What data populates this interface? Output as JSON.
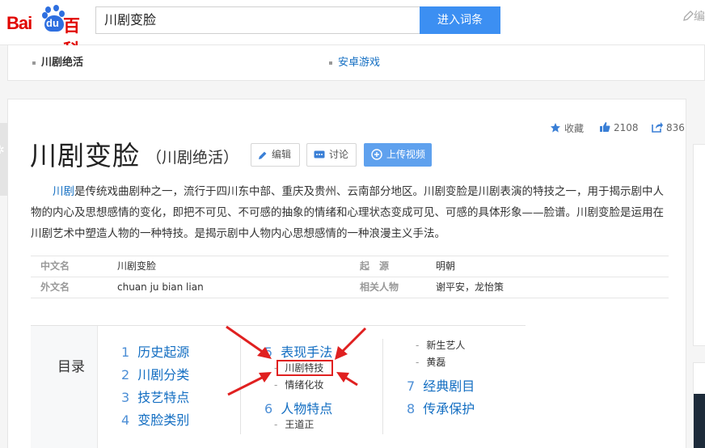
{
  "header": {
    "logo": {
      "bai": "Bai",
      "du": "du",
      "baike": "百科"
    },
    "search_value": "川剧变脸",
    "search_button": "进入词条",
    "edit_partial": "编"
  },
  "poly_links": [
    {
      "label": "川剧绝活",
      "current": true
    },
    {
      "label": "安卓游戏",
      "current": false
    }
  ],
  "stats": {
    "collect_label": "收藏",
    "likes": "2108",
    "shares": "836"
  },
  "entry": {
    "title": "川剧变脸",
    "subtitle": "（川剧绝活）",
    "buttons": {
      "edit": "编辑",
      "discuss": "讨论",
      "upload": "上传视频"
    }
  },
  "summary": {
    "link": "川剧",
    "text": "是传统戏曲剧种之一，流行于四川东中部、重庆及贵州、云南部分地区。川剧变脸是川剧表演的特技之一，用于揭示剧中人物的内心及思想感情的变化，即把不可见、不可感的抽象的情绪和心理状态变成可见、可感的具体形象——脸谱。川剧变脸是运用在川剧艺术中塑造人物的一种特技。是揭示剧中人物内心思想感情的一种浪漫主义手法。"
  },
  "basic_info": [
    {
      "k1": "中文名",
      "v1": "川剧变脸",
      "k2": "起　源",
      "v2": "明朝"
    },
    {
      "k1": "外文名",
      "v1": "chuan ju bian lian",
      "k2": "相关人物",
      "v2": "谢平安，龙怡策"
    }
  ],
  "catalog": {
    "title": "目录",
    "items": [
      {
        "num": "1",
        "label": "历史起源"
      },
      {
        "num": "2",
        "label": "川剧分类"
      },
      {
        "num": "3",
        "label": "技艺特点"
      },
      {
        "num": "4",
        "label": "变脸类别"
      },
      {
        "num": "5",
        "label": "表现手法"
      },
      {
        "num": "6",
        "label": "人物特点"
      },
      {
        "num": "7",
        "label": "经典剧目"
      },
      {
        "num": "8",
        "label": "传承保护"
      }
    ],
    "subitems": {
      "s5a": "川剧特技",
      "s5b": "情绪化妆",
      "s6a": "王道正",
      "s6b": "新生艺人",
      "s6c": "黄磊"
    }
  },
  "colors": {
    "brand_red": "#e10601",
    "brand_blue": "#2e6fe0",
    "link": "#136ec2",
    "button": "#3c8ff2",
    "annotation": "#e02020"
  }
}
